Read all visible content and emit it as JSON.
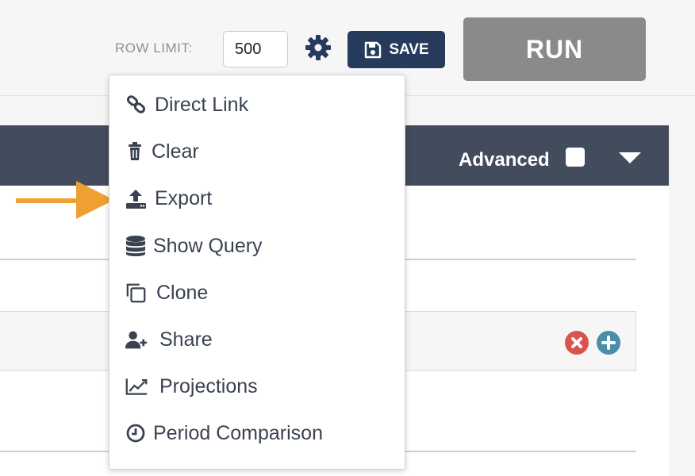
{
  "toolbar": {
    "row_limit_label": "ROW LIMIT:",
    "row_limit_value": "500",
    "settings_icon": "gear-icon",
    "save_label": "SAVE",
    "save_icon": "floppy-disk-icon",
    "run_label": "RUN"
  },
  "panel": {
    "advanced_label": "Advanced",
    "advanced_checked": false
  },
  "menu": {
    "items": [
      {
        "label": "Direct Link",
        "icon": "link-icon"
      },
      {
        "label": "Clear",
        "icon": "trash-icon"
      },
      {
        "label": "Export",
        "icon": "upload-icon"
      },
      {
        "label": "Show Query",
        "icon": "database-icon"
      },
      {
        "label": "Clone",
        "icon": "clone-icon"
      },
      {
        "label": "Share",
        "icon": "user-plus-icon"
      },
      {
        "label": "Projections",
        "icon": "line-chart-icon"
      },
      {
        "label": "Period Comparison",
        "icon": "clock-icon"
      }
    ]
  },
  "colors": {
    "save_bg": "#263a5c",
    "run_bg": "#8a8a8a",
    "panel_header": "#434c5c",
    "remove": "#d9534f",
    "add": "#4a8ea8",
    "arrow": "#f0a030",
    "menu_text": "#3a4250"
  }
}
